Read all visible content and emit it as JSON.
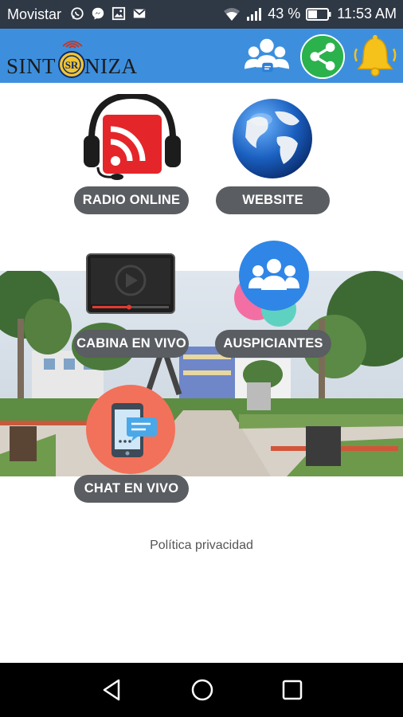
{
  "status_bar": {
    "carrier": "Movistar",
    "notification_icons": [
      "whatsapp-icon",
      "messenger-icon",
      "gallery-icon",
      "email-icon"
    ],
    "battery": "43 %",
    "time": "11:53 AM"
  },
  "app_bar": {
    "logo_text_left": "SINT",
    "logo_text_right": "NIZA",
    "actions": [
      "group-chat-icon",
      "share-icon",
      "notification-bell-icon"
    ]
  },
  "menu": {
    "radio_online": "RADIO ONLINE",
    "website": "WEBSITE",
    "cabina_en_vivo": "CABINA EN VIVO",
    "auspiciantes": "AUSPICIANTES",
    "chat_en_vivo": "CHAT EN VIVO"
  },
  "footer": {
    "privacy": "Política privacidad"
  },
  "colors": {
    "app_bar": "#3d8fdd",
    "status_bar": "#2f3845",
    "pill": "#5a5d61",
    "share_green": "#2bb24c",
    "bell_yellow": "#f5c21b"
  }
}
